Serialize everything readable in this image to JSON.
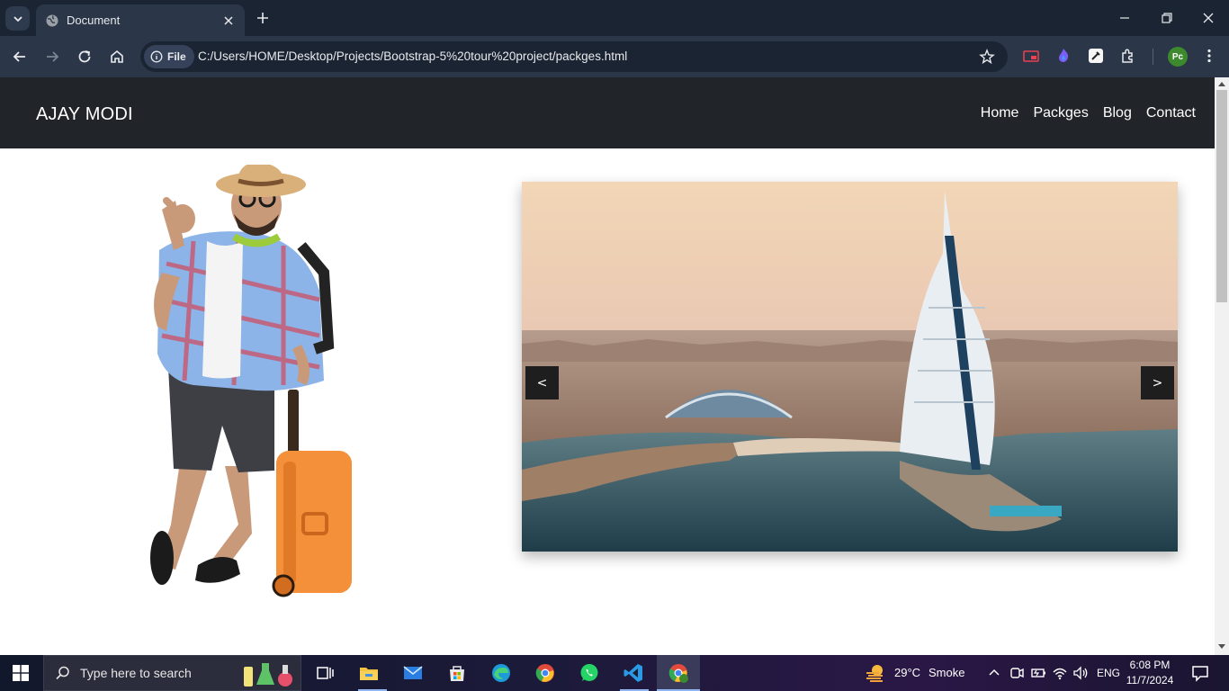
{
  "browser": {
    "tab_title": "Document",
    "url_chip": "File",
    "url": "C:/Users/HOME/Desktop/Projects/Bootstrap-5%20tour%20project/packges.html",
    "profile_initials": "Pc"
  },
  "site": {
    "brand": "AJAY MODI",
    "nav": [
      {
        "label": "Home"
      },
      {
        "label": "Packges"
      },
      {
        "label": "Blog"
      },
      {
        "label": "Contact"
      }
    ],
    "carousel": {
      "prev_label": "<",
      "next_label": ">"
    }
  },
  "taskbar": {
    "search_placeholder": "Type here to search",
    "weather_temp": "29°C",
    "weather_desc": "Smoke",
    "language": "ENG",
    "time": "6:08 PM",
    "date": "11/7/2024"
  },
  "colors": {
    "navbar_bg": "#212529",
    "browser_toolbar": "#2b3648",
    "carousel_button": "#1e1e1e"
  }
}
